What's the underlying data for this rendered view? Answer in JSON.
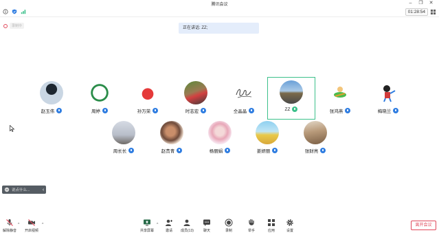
{
  "window": {
    "title": "腾讯会议"
  },
  "status": {
    "timer": "01:28:54"
  },
  "recording": {
    "label": "录制中"
  },
  "banner": {
    "speaking": "正在讲话: ZZ;"
  },
  "participants_row1": [
    {
      "name": "赵玉伟"
    },
    {
      "name": "周婷"
    },
    {
      "name": "孙万荣"
    },
    {
      "name": "时志宏"
    },
    {
      "name": "仝晶晶"
    },
    {
      "name": "ZZ"
    },
    {
      "name": "张鸿燕"
    },
    {
      "name": "梅晓兰"
    }
  ],
  "participants_row2": [
    {
      "name": "周长长"
    },
    {
      "name": "赵贵青"
    },
    {
      "name": "杨丽娟"
    },
    {
      "name": "姜妍丽"
    },
    {
      "name": "张财亮"
    }
  ],
  "chat": {
    "placeholder": "说点什么..."
  },
  "toolbar": {
    "unmute": "解除静音",
    "video": "开启视频",
    "share": "共享屏幕",
    "invite": "邀请",
    "members": "成员(13)",
    "chat": "聊天",
    "record": "录制",
    "raise": "举手",
    "apps": "应用",
    "settings": "设置",
    "leave": "离开会议"
  },
  "colors": {
    "active_border": "#3bc08a",
    "mic_blue": "#2f7de1",
    "leave_red": "#e0485a"
  }
}
